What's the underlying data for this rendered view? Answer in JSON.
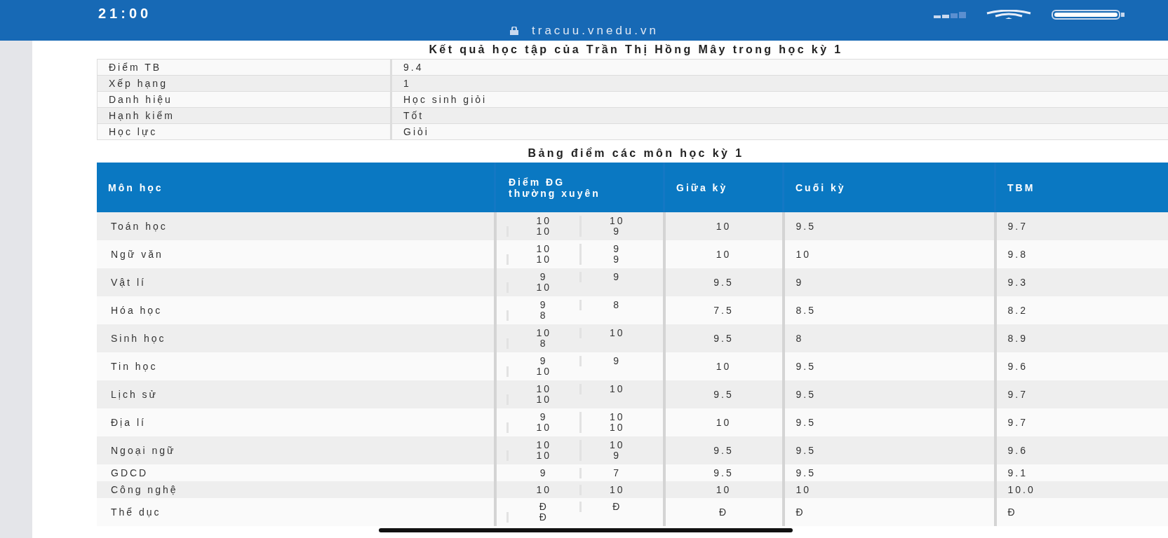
{
  "status_bar": {
    "time": "21:00",
    "url": "tracuu.vnedu.vn"
  },
  "summary": {
    "title": "Kết quả học tập của Trần Thị Hồng Mây trong học kỳ 1",
    "rows": [
      {
        "label": "Điểm TB",
        "value": "9.4"
      },
      {
        "label": "Xếp hạng",
        "value": "1"
      },
      {
        "label": "Danh hiệu",
        "value": "Học sinh giỏi"
      },
      {
        "label": "Hạnh kiểm",
        "value": "Tốt"
      },
      {
        "label": "Học lực",
        "value": "Giỏi"
      }
    ]
  },
  "grades": {
    "title": "Bảng điểm các môn học kỳ 1",
    "columns": [
      "Môn học",
      "Điểm ĐG thường xuyên",
      "Giữa kỳ",
      "Cuối kỳ",
      "TBM"
    ],
    "rows": [
      {
        "subject": "Toán học",
        "regular": [
          "10",
          "10",
          "10",
          "9"
        ],
        "midterm": "10",
        "final": "9.5",
        "average": "9.7"
      },
      {
        "subject": "Ngữ văn",
        "regular": [
          "10",
          "9",
          "10",
          "9"
        ],
        "midterm": "10",
        "final": "10",
        "average": "9.8"
      },
      {
        "subject": "Vật lí",
        "regular": [
          "9",
          "9",
          "10"
        ],
        "midterm": "9.5",
        "final": "9",
        "average": "9.3"
      },
      {
        "subject": "Hóa học",
        "regular": [
          "9",
          "8",
          "8"
        ],
        "midterm": "7.5",
        "final": "8.5",
        "average": "8.2"
      },
      {
        "subject": "Sinh học",
        "regular": [
          "10",
          "10",
          "8"
        ],
        "midterm": "9.5",
        "final": "8",
        "average": "8.9"
      },
      {
        "subject": "Tin học",
        "regular": [
          "9",
          "9",
          "10"
        ],
        "midterm": "10",
        "final": "9.5",
        "average": "9.6"
      },
      {
        "subject": "Lịch sử",
        "regular": [
          "10",
          "10",
          "10"
        ],
        "midterm": "9.5",
        "final": "9.5",
        "average": "9.7"
      },
      {
        "subject": "Địa lí",
        "regular": [
          "9",
          "10",
          "10",
          "10"
        ],
        "midterm": "10",
        "final": "9.5",
        "average": "9.7"
      },
      {
        "subject": "Ngoại ngữ",
        "regular": [
          "10",
          "10",
          "10",
          "9"
        ],
        "midterm": "9.5",
        "final": "9.5",
        "average": "9.6"
      },
      {
        "subject": "GDCD",
        "regular": [
          "9",
          "7"
        ],
        "midterm": "9.5",
        "final": "9.5",
        "average": "9.1"
      },
      {
        "subject": "Công nghệ",
        "regular": [
          "10",
          "10"
        ],
        "midterm": "10",
        "final": "10",
        "average": "10.0"
      },
      {
        "subject": "Thể dục",
        "regular": [
          "Đ",
          "Đ",
          "Đ"
        ],
        "midterm": "Đ",
        "final": "Đ",
        "average": "Đ"
      }
    ]
  }
}
